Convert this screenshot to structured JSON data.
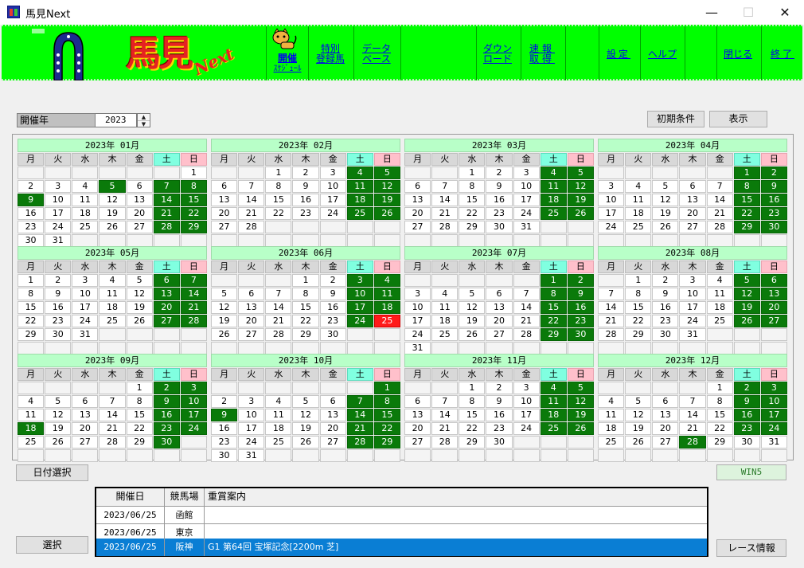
{
  "window": {
    "title": "馬見Next",
    "minimize": "—",
    "maximize": "☐",
    "close": "✕"
  },
  "toolbar": {
    "logo_text": "馬見",
    "logo_next": "Next",
    "links": [
      {
        "id": "schedule",
        "line1": "開催",
        "line2": "ｽｹｼﾞｭｰﾙ"
      },
      {
        "id": "special",
        "line1": "特別",
        "line2": "登録馬"
      },
      {
        "id": "database",
        "line1": "データ",
        "line2": "ベース"
      },
      {
        "id": "download",
        "line1": "ダウン",
        "line2": "ロード"
      },
      {
        "id": "fast",
        "line1": "速報",
        "line2": "取得"
      },
      {
        "id": "settings",
        "line1": "設定",
        "line2": ""
      },
      {
        "id": "help",
        "line1": "ヘルプ",
        "line2": ""
      },
      {
        "id": "close",
        "line1": "閉じる",
        "line2": ""
      },
      {
        "id": "exit",
        "line1": "終了",
        "line2": ""
      }
    ]
  },
  "filter": {
    "label": "開催年",
    "year": "2023",
    "init_button": "初期条件",
    "show_button": "表示"
  },
  "weekdays": [
    "月",
    "火",
    "水",
    "木",
    "金",
    "土",
    "日"
  ],
  "calendar": [
    {
      "title": "2023年 01月",
      "offset": 6,
      "days": 31,
      "race": [
        5,
        7,
        8,
        9,
        14,
        15,
        21,
        22,
        28,
        29
      ],
      "selected": []
    },
    {
      "title": "2023年 02月",
      "offset": 2,
      "days": 28,
      "race": [
        4,
        5,
        11,
        12,
        18,
        19,
        25,
        26
      ],
      "selected": []
    },
    {
      "title": "2023年 03月",
      "offset": 2,
      "days": 31,
      "race": [
        4,
        5,
        11,
        12,
        18,
        19,
        25,
        26
      ],
      "selected": []
    },
    {
      "title": "2023年 04月",
      "offset": 5,
      "days": 30,
      "race": [
        1,
        2,
        8,
        9,
        15,
        16,
        22,
        23,
        29,
        30
      ],
      "selected": []
    },
    {
      "title": "2023年 05月",
      "offset": 0,
      "days": 31,
      "race": [
        6,
        7,
        13,
        14,
        20,
        21,
        27,
        28
      ],
      "selected": []
    },
    {
      "title": "2023年 06月",
      "offset": 3,
      "days": 30,
      "race": [
        3,
        4,
        10,
        11,
        17,
        18,
        24,
        25
      ],
      "selected": [
        25
      ]
    },
    {
      "title": "2023年 07月",
      "offset": 5,
      "days": 31,
      "race": [
        1,
        2,
        8,
        9,
        15,
        16,
        22,
        23,
        29,
        30
      ],
      "selected": []
    },
    {
      "title": "2023年 08月",
      "offset": 1,
      "days": 31,
      "race": [
        5,
        6,
        12,
        13,
        19,
        20,
        26,
        27
      ],
      "selected": []
    },
    {
      "title": "2023年 09月",
      "offset": 4,
      "days": 30,
      "race": [
        2,
        3,
        9,
        10,
        16,
        17,
        18,
        23,
        24,
        30
      ],
      "selected": []
    },
    {
      "title": "2023年 10月",
      "offset": 6,
      "days": 31,
      "race": [
        1,
        7,
        8,
        9,
        14,
        15,
        21,
        22,
        28,
        29
      ],
      "selected": []
    },
    {
      "title": "2023年 11月",
      "offset": 2,
      "days": 30,
      "race": [
        4,
        5,
        11,
        12,
        18,
        19,
        25,
        26
      ],
      "selected": []
    },
    {
      "title": "2023年 12月",
      "offset": 4,
      "days": 31,
      "race": [
        2,
        3,
        9,
        10,
        16,
        17,
        23,
        24,
        28
      ],
      "selected": []
    }
  ],
  "buttons": {
    "date_select": "日付選択",
    "win5": "WIN5",
    "select": "選択",
    "race_info": "レース情報"
  },
  "table": {
    "headers": [
      "開催日",
      "競馬場",
      "重賞案内"
    ],
    "rows": [
      {
        "date": "2023/06/25",
        "course": "函館",
        "info": ""
      },
      {
        "date": "2023/06/25",
        "course": "東京",
        "info": ""
      },
      {
        "date": "2023/06/25",
        "course": "阪神",
        "info": "G1 第64回 宝塚記念[2200m 芝]"
      }
    ]
  }
}
